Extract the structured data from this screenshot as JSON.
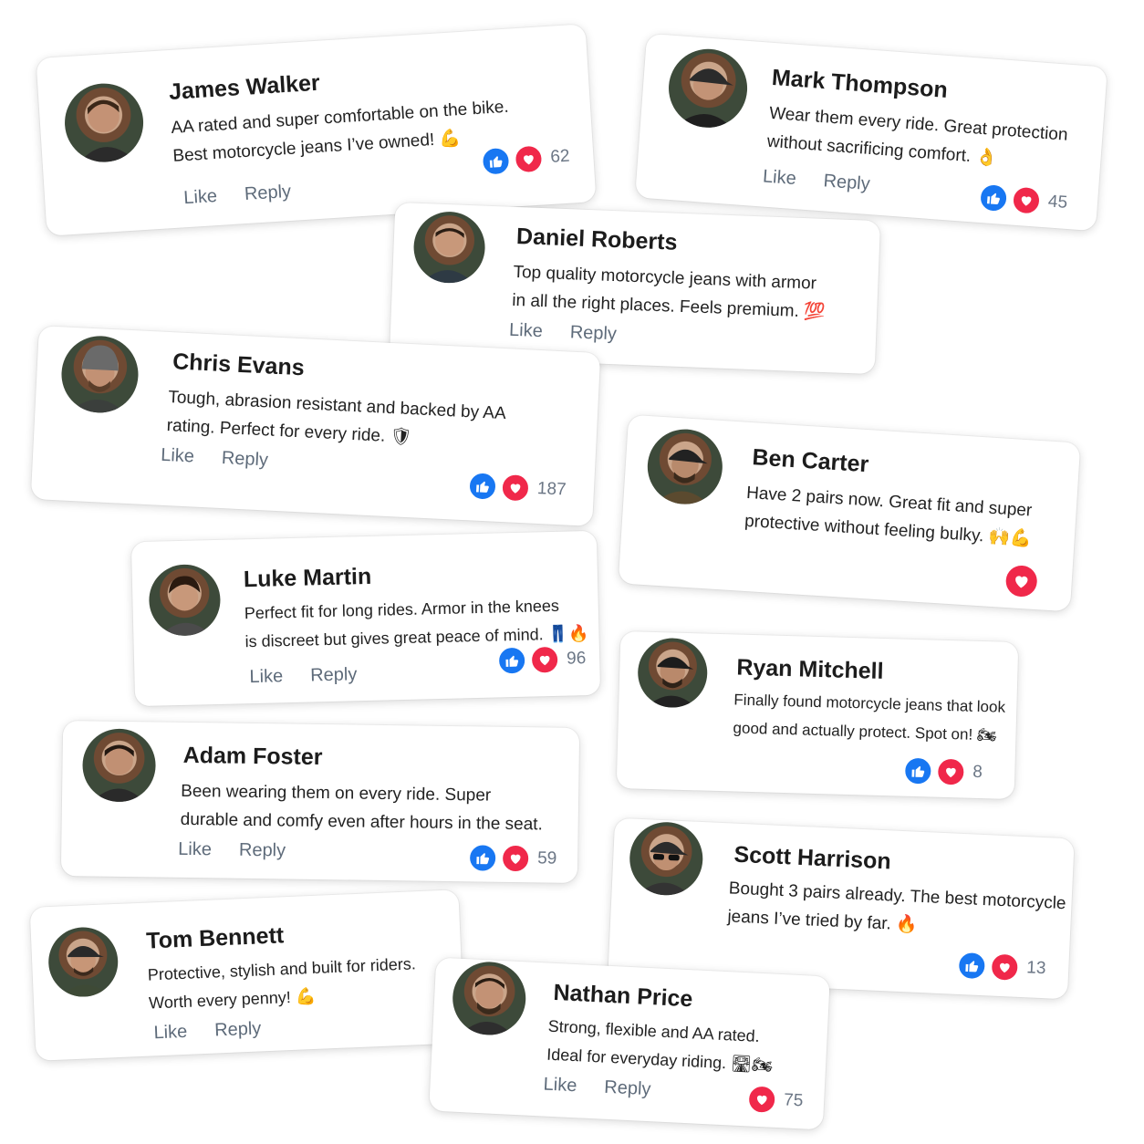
{
  "colors": {
    "like_blue": "#1877f2",
    "love_red": "#f0284a",
    "action_gray": "#5e6b7a"
  },
  "icons": {
    "like": "thumbs-up-icon",
    "love": "heart-icon"
  },
  "comments": [
    {
      "name": "James Walker",
      "line1": "AA rated and super comfortable on the bike.",
      "line2": "Best motorcycle jeans I’ve owned! 💪",
      "like": "Like",
      "reply": "Reply",
      "count": "62"
    },
    {
      "name": "Mark Thompson",
      "line1": "Wear them every ride. Great protection",
      "line2": "without sacrificing comfort. 👌",
      "like": "Like",
      "reply": "Reply",
      "count": "45"
    },
    {
      "name": "Daniel Roberts",
      "line1": "Top quality motorcycle jeans with armor",
      "line2": "in all the right places. Feels premium. 💯",
      "like": "Like",
      "reply": "Reply",
      "count": ""
    },
    {
      "name": "Chris Evans",
      "line1": "Tough, abrasion resistant and backed by AA",
      "line2": "rating. Perfect for every ride. 🛡",
      "like": "Like",
      "reply": "Reply",
      "count": "187"
    },
    {
      "name": "Ben Carter",
      "line1": "Have 2 pairs now. Great fit and super",
      "line2": "protective without feeling bulky. 🙌💪",
      "like": "",
      "reply": "",
      "count": ""
    },
    {
      "name": "Luke Martin",
      "line1": "Perfect fit for long rides. Armor in the knees",
      "line2": "is discreet but gives great peace of mind. 👖🔥",
      "like": "Like",
      "reply": "Reply",
      "count": "96"
    },
    {
      "name": "Ryan Mitchell",
      "line1": "Finally found motorcycle jeans that look",
      "line2": "good and actually protect. Spot on! 🏍",
      "like": "",
      "reply": "",
      "count": "8"
    },
    {
      "name": "Adam Foster",
      "line1": "Been wearing them on every ride. Super",
      "line2": "durable and comfy even after hours in the seat.",
      "like": "Like",
      "reply": "Reply",
      "count": "59"
    },
    {
      "name": "Scott Harrison",
      "line1": "Bought 3 pairs already. The best motorcycle",
      "line2": "jeans I’ve tried by far. 🔥",
      "like": "",
      "reply": "",
      "count": "13"
    },
    {
      "name": "Tom Bennett",
      "line1": "Protective, stylish and built for riders.",
      "line2": "Worth every penny! 💪",
      "like": "Like",
      "reply": "Reply",
      "count": ""
    },
    {
      "name": "Nathan Price",
      "line1": "Strong, flexible and AA rated.",
      "line2": "Ideal for everyday riding. 🛣🏍",
      "like": "Like",
      "reply": "Reply",
      "count": "75"
    }
  ]
}
